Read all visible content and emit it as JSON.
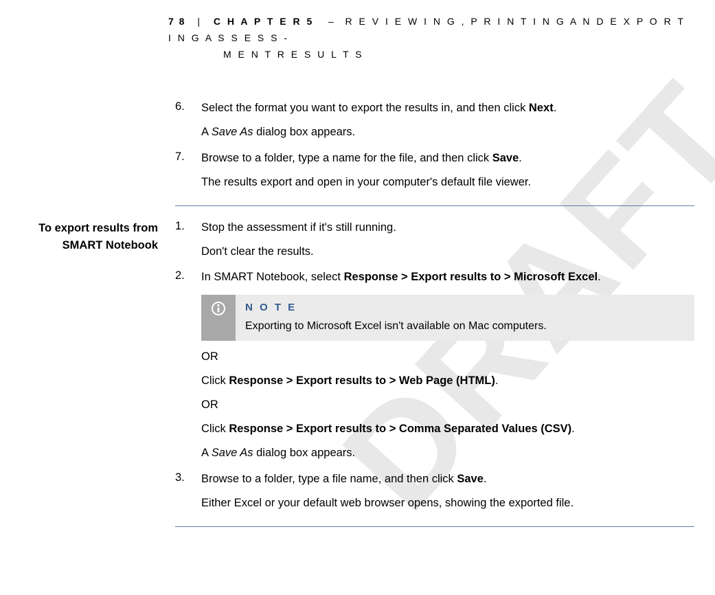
{
  "watermark": "DRAFT",
  "header": {
    "page_number": "7 8",
    "divider": "|",
    "chapter_label": "C H A P T E R   5",
    "dash": "–",
    "title_line1": "R E V I E W I N G ,   P R I N T I N G   A N D   E X P O R T I N G   A S S E S S -",
    "title_line2": "M E N T   R E S U L T S"
  },
  "section1": {
    "steps": [
      {
        "num": "6.",
        "text_pre": "Select the format you want to export the results in, and then click ",
        "text_bold": "Next",
        "text_post": ".",
        "follow_pre": "A ",
        "follow_italic": "Save As",
        "follow_post": " dialog box appears."
      },
      {
        "num": "7.",
        "text_pre": "Browse to a folder, type a name for the file, and then click ",
        "text_bold": "Save",
        "text_post": ".",
        "follow": "The results export and open in your computer's default file viewer."
      }
    ]
  },
  "section2": {
    "heading_line1": "To export results from",
    "heading_line2": "SMART Notebook",
    "step1": {
      "num": "1.",
      "text": "Stop the assessment if it's still running.",
      "follow": "Don't clear the results."
    },
    "step2": {
      "num": "2.",
      "text_pre": "In SMART Notebook, select ",
      "text_bold": "Response > Export results to > Microsoft Excel",
      "text_post": ".",
      "note_label": "N O T E",
      "note_text": "Exporting to Microsoft Excel isn't available on Mac computers.",
      "or1": "OR",
      "alt1_pre": "Click ",
      "alt1_bold": "Response > Export results to > Web Page (HTML)",
      "alt1_post": ".",
      "or2": "OR",
      "alt2_pre": "Click ",
      "alt2_bold": "Response > Export results to > Comma Separated Values (CSV)",
      "alt2_post": ".",
      "saveas_pre": "A ",
      "saveas_italic": "Save As",
      "saveas_post": " dialog box appears."
    },
    "step3": {
      "num": "3.",
      "text_pre": "Browse to a folder, type a file name, and then click ",
      "text_bold": "Save",
      "text_post": ".",
      "follow": "Either Excel or your default web browser opens, showing the exported file."
    }
  }
}
